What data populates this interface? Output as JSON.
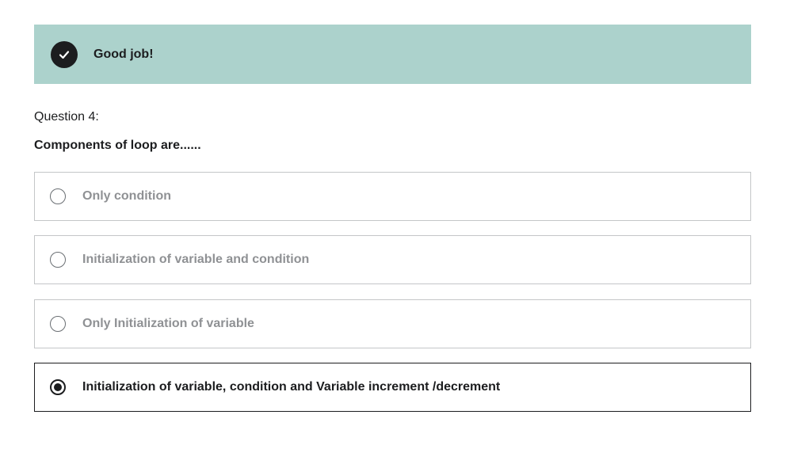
{
  "feedback": {
    "icon": "check-circle-icon",
    "message": "Good job!",
    "background_color": "#acd2cc"
  },
  "question": {
    "number_label": "Question 4:",
    "prompt": "Components of loop are......"
  },
  "options": [
    {
      "label": "Only condition",
      "selected": false
    },
    {
      "label": "Initialization of variable and condition",
      "selected": false
    },
    {
      "label": "Only Initialization of variable",
      "selected": false
    },
    {
      "label": "Initialization of variable, condition and Variable increment /decrement",
      "selected": true
    }
  ]
}
